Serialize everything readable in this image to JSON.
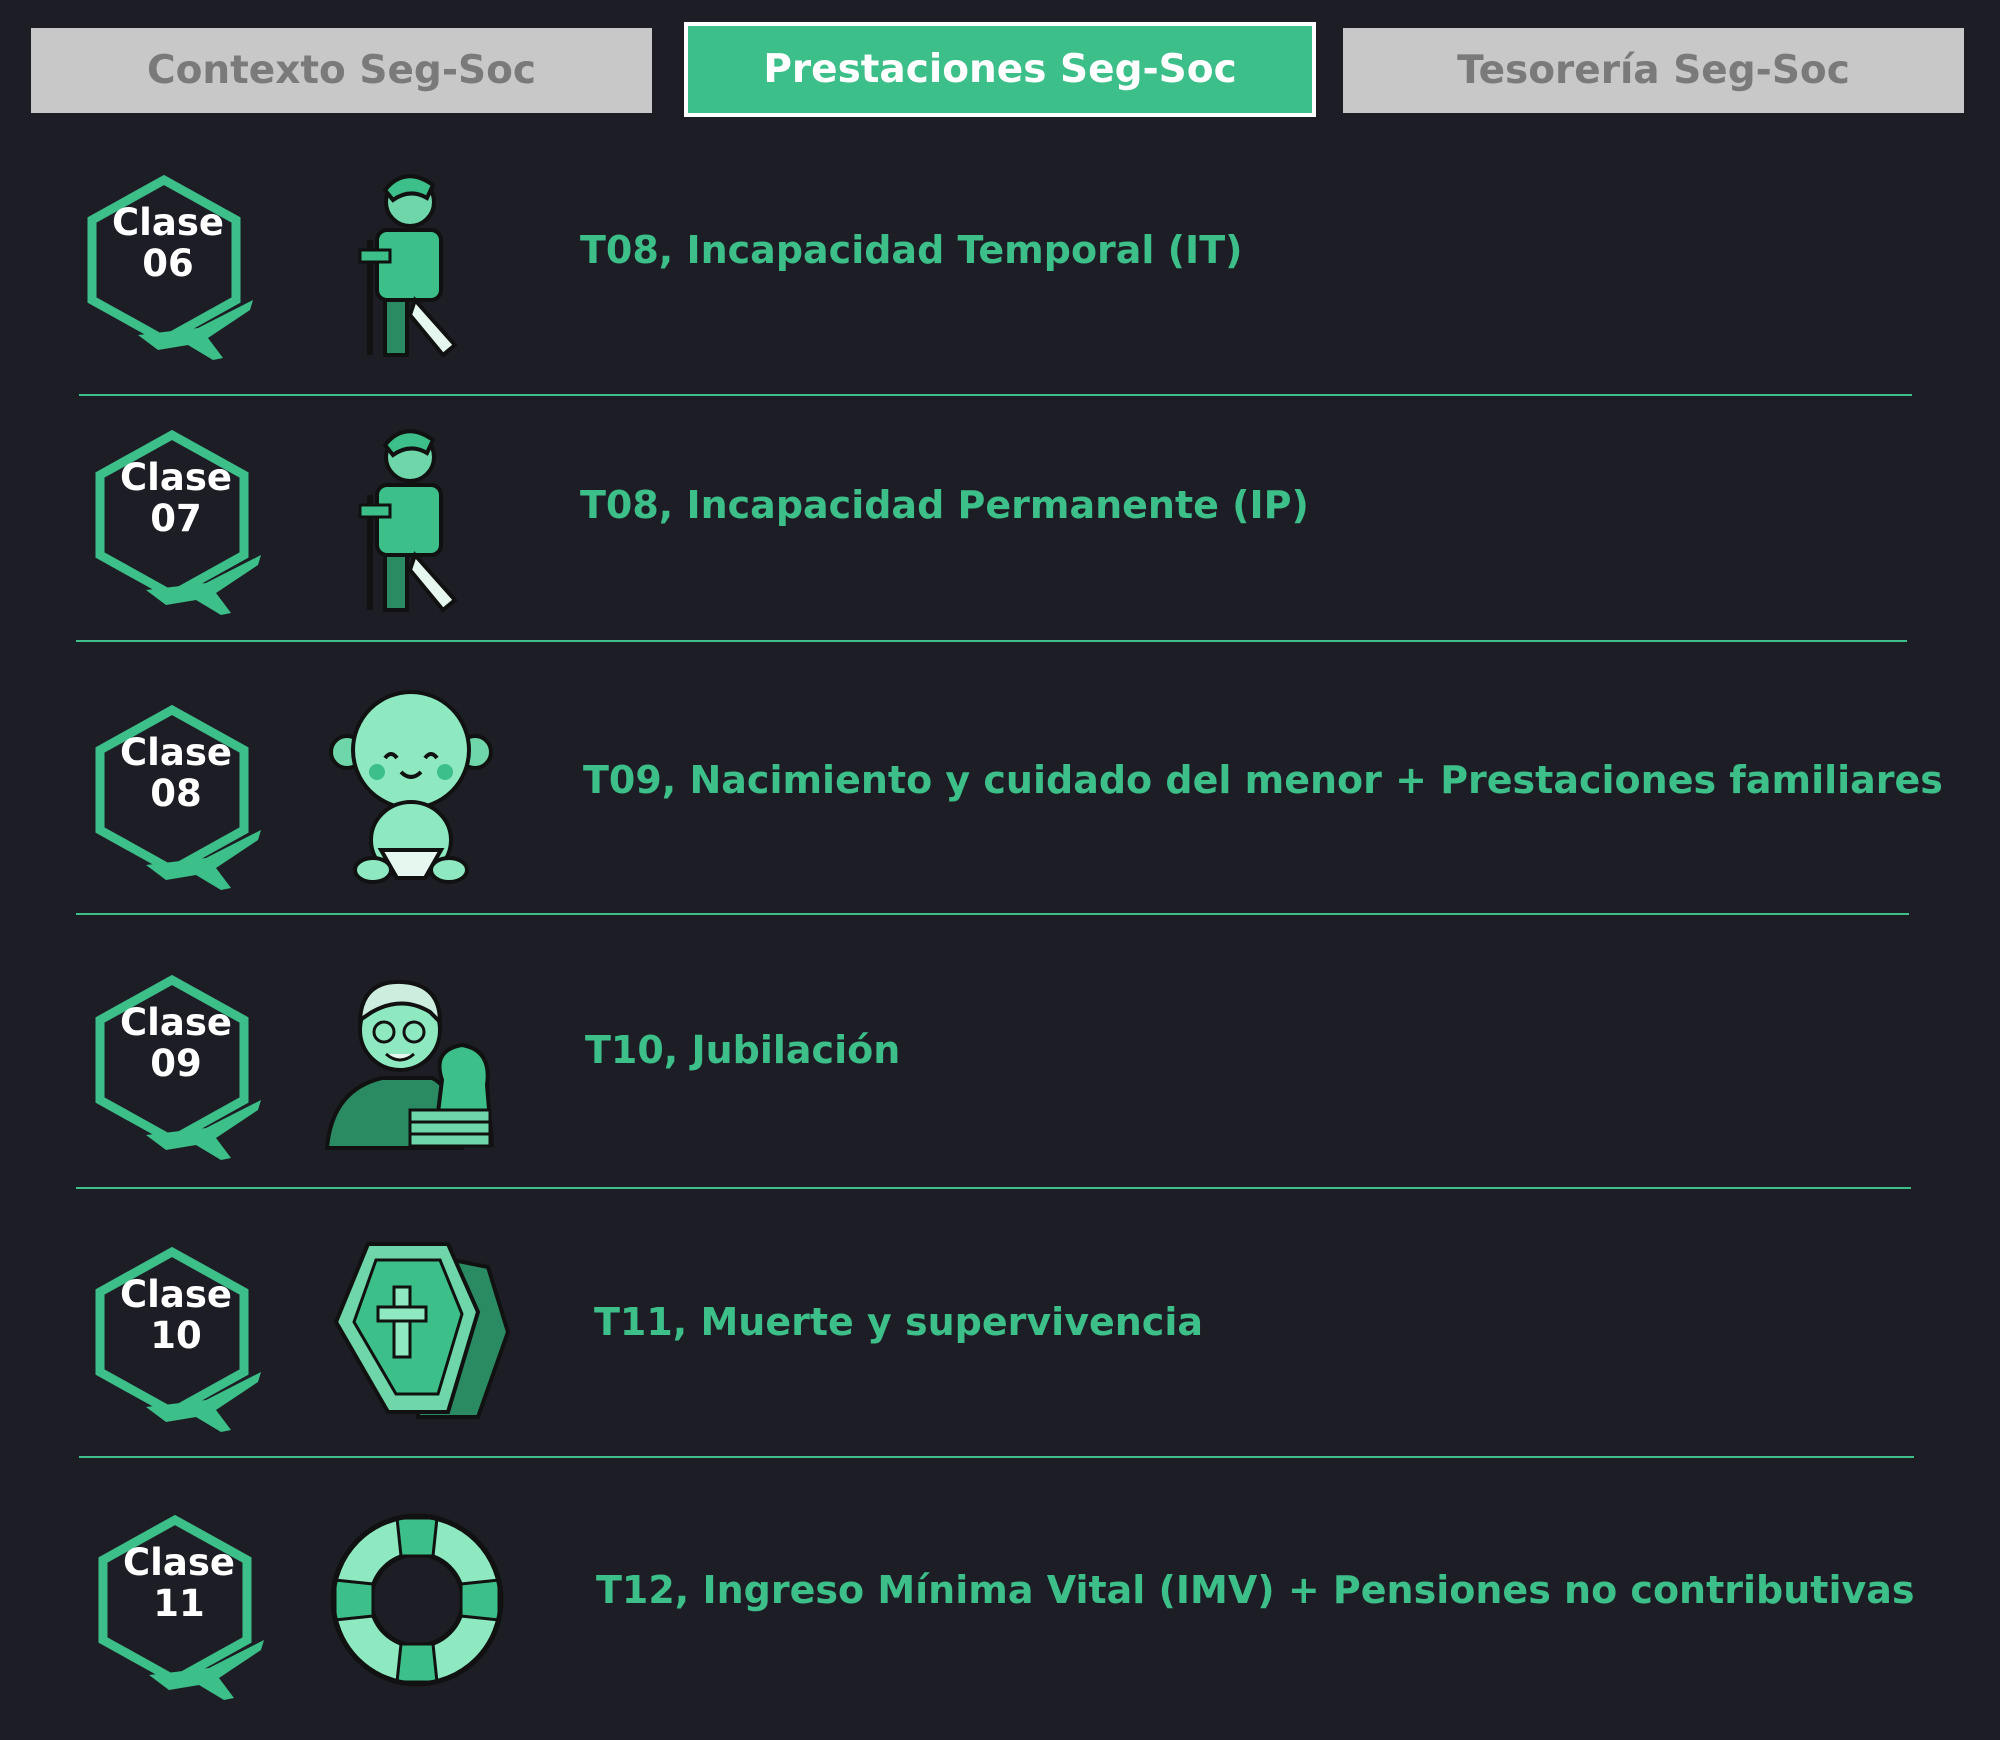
{
  "tabs": [
    {
      "label": "Contexto Seg-Soc",
      "active": false
    },
    {
      "label": "Prestaciones Seg-Soc",
      "active": true
    },
    {
      "label": "Tesorería Seg-Soc",
      "active": false
    }
  ],
  "rows": [
    {
      "clase_word": "Clase",
      "clase_num": "06",
      "topic": "T08, Incapacidad Temporal (IT)",
      "icon": "injured-person-crutch-icon"
    },
    {
      "clase_word": "Clase",
      "clase_num": "07",
      "topic": "T08, Incapacidad Permanente (IP)",
      "icon": "injured-person-crutch-icon"
    },
    {
      "clase_word": "Clase",
      "clase_num": "08",
      "topic": "T09, Nacimiento y cuidado del menor + Prestaciones familiares",
      "icon": "baby-icon"
    },
    {
      "clase_word": "Clase",
      "clase_num": "09",
      "topic": "T10, Jubilación",
      "icon": "retired-man-money-bag-icon"
    },
    {
      "clase_word": "Clase",
      "clase_num": "10",
      "topic": "T11, Muerte y supervivencia",
      "icon": "coffin-icon"
    },
    {
      "clase_word": "Clase",
      "clase_num": "11",
      "topic": "T12, Ingreso Mínima Vital (IMV) + Pensiones no contributivas",
      "icon": "lifebuoy-icon"
    }
  ],
  "colors": {
    "accent": "#3cbf88",
    "background": "#1d1e25",
    "inactive_tab": "#c8c8c8",
    "inactive_tab_text": "#7a7a7a"
  }
}
